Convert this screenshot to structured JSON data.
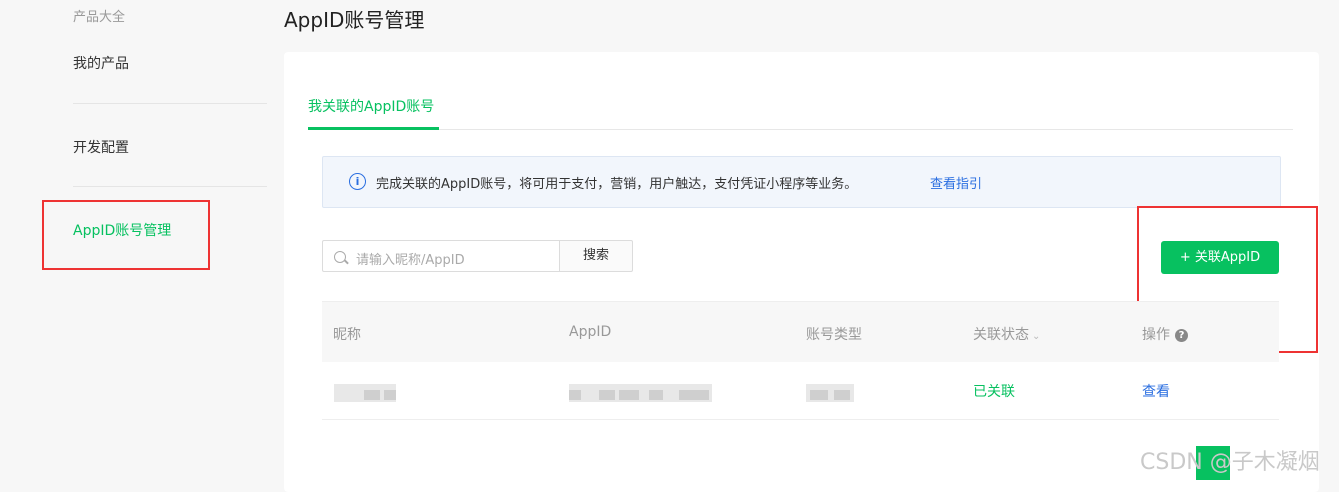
{
  "sidebar": {
    "items": [
      {
        "label": "产品大全"
      },
      {
        "label": "我的产品"
      },
      {
        "label": "开发配置"
      },
      {
        "label": "AppID账号管理",
        "active": true
      }
    ]
  },
  "header": {
    "title": "AppID账号管理"
  },
  "tabs": [
    {
      "label": "我关联的AppID账号",
      "active": true
    }
  ],
  "notice": {
    "text": "完成关联的AppID账号，将可用于支付，营销，用户触达，支付凭证小程序等业务。",
    "link": "查看指引"
  },
  "search": {
    "placeholder": "请输入昵称/AppID",
    "button": "搜索"
  },
  "actions": {
    "add_label": "+ 关联AppID"
  },
  "table": {
    "columns": [
      "昵称",
      "AppID",
      "账号类型",
      "关联状态",
      "操作"
    ],
    "rows": [
      {
        "status": "已关联",
        "action": "查看"
      }
    ]
  },
  "watermark": {
    "text": "CSDN @子木凝烟"
  },
  "colors": {
    "accent": "#07c160",
    "link": "#2a6ee0",
    "highlight": "#ee3333"
  }
}
